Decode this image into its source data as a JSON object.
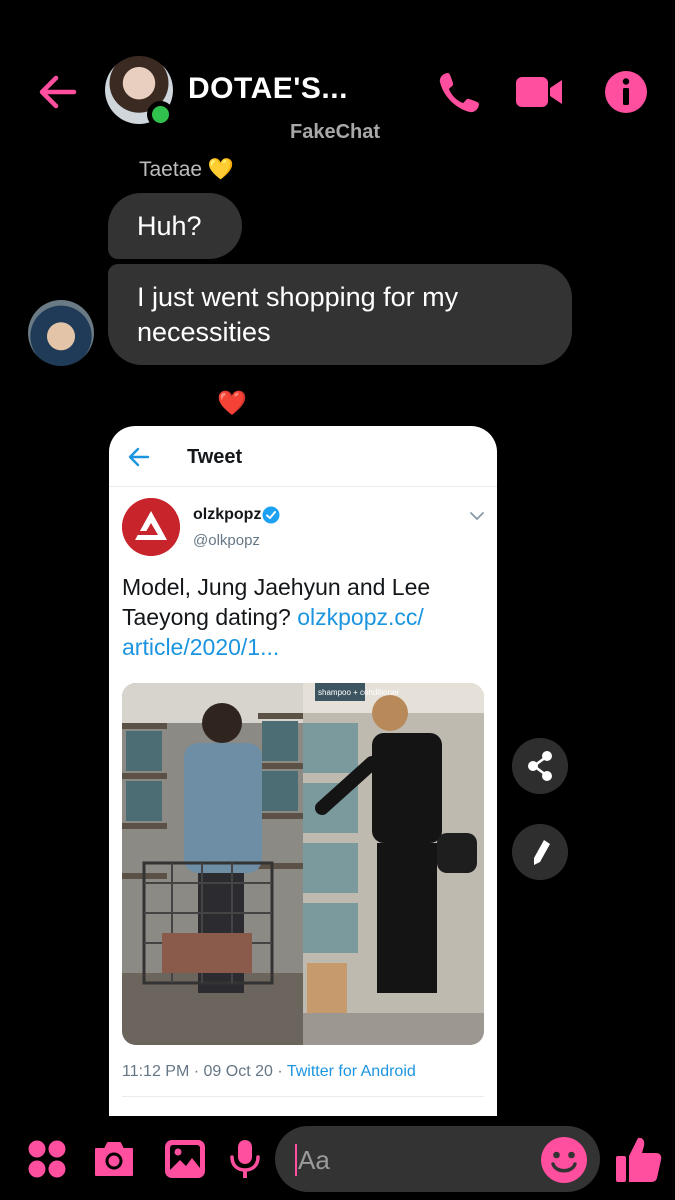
{
  "header": {
    "title": "DOTAE'S...",
    "subtitle": "FakeChat",
    "icons": [
      "back-arrow-icon",
      "phone-icon",
      "video-camera-icon",
      "info-icon"
    ],
    "accent_color": "#ff4f9e",
    "online_color": "#31c24d"
  },
  "messages": {
    "sender_name": "Taetae",
    "sender_emoji": "💛",
    "items": [
      {
        "text": "Huh?"
      },
      {
        "text": "I just went shopping for my necessities"
      }
    ],
    "reaction": "❤️"
  },
  "tweet": {
    "header_title": "Tweet",
    "author_name": "olzkpopz",
    "author_handle": "@olkpopz",
    "body_text": "Model, Jung Jaehyun and Lee Taeyong dating?",
    "link_text": "olzkpopz.cc/ article/2020/1...",
    "timestamp": "11:12 PM · 09 Oct 20 · ",
    "source": "Twitter for Android",
    "media_sign": "shampoo + conditioner"
  },
  "side_actions": [
    "share-icon",
    "edit-icon"
  ],
  "composer": {
    "placeholder": "Aa",
    "icons": [
      "apps-icon",
      "camera-icon",
      "image-icon",
      "microphone-icon",
      "emoji-icon",
      "thumbs-up-icon"
    ]
  }
}
